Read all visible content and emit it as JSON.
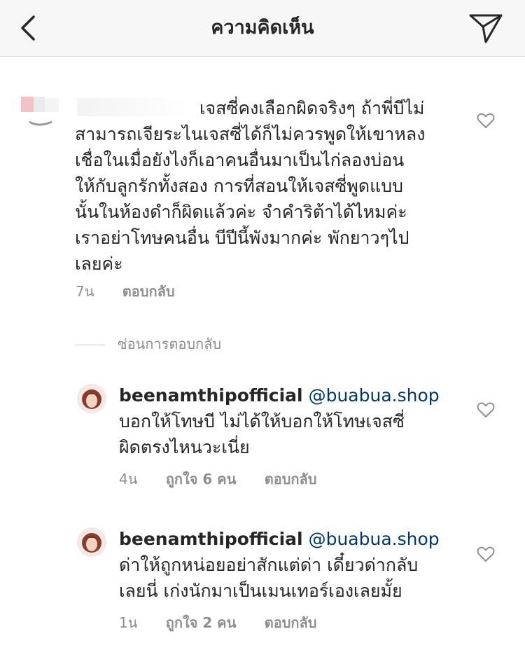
{
  "header": {
    "title": "ความคิดเห็น",
    "back_icon": "chevron-left-icon",
    "send_icon": "paper-plane-icon"
  },
  "comment_main": {
    "text_lines": [
      "เจสซี่คงเลือกผิดจริงๆ ถ้าพี่บีไม่",
      "สามารถเจียระไนเจสซี่ได้ก็ไม่ควรพูดให้เขาหลง",
      "เชื่อในเมื่อยังไงก็เอาคนอื่นมาเป็นไก่ลองบ่อน",
      "ให้กับลูกรักทั้งสอง การที่สอนให้เจสซี่พูดแบบ",
      "นั้นในห้องดำก็ผิดแล้วค่ะ จำคำริต้าได้ไหมค่ะ",
      "เราอย่าโทษคนอื่น บีปีนี้พังมากค่ะ พักยาวๆไป",
      "เลยค่ะ"
    ],
    "time": "7น",
    "reply_label": "ตอบกลับ"
  },
  "hide_replies_label": "ซ่อนการตอบกลับ",
  "replies": [
    {
      "username": "beenamthipofficial",
      "mention": "@buabua.shop",
      "line1": "บอกให้โทษบี ไม่ได้ให้บอกให้โทษเจสซี่",
      "line2": "ผิดตรงไหนวะเนี่ย",
      "time": "4น",
      "likes": "ถูกใจ 6 คน",
      "reply_label": "ตอบกลับ"
    },
    {
      "username": "beenamthipofficial",
      "mention": "@buabua.shop",
      "line1": "ด่าให้ถูกหน่อยอย่าสักแต่ด่า เดี๋ยวด่ากลับ",
      "line2": "เลยนี่ เก่งนักมาเป็นเมนเทอร์เองเลยมั้ย",
      "time": "1น",
      "likes": "ถูกใจ 2 คน",
      "reply_label": "ตอบกลับ"
    }
  ],
  "colors": {
    "text": "#262626",
    "secondary": "#8e8e8e",
    "mention": "#00376b",
    "header_bg": "#f7f7f7"
  }
}
